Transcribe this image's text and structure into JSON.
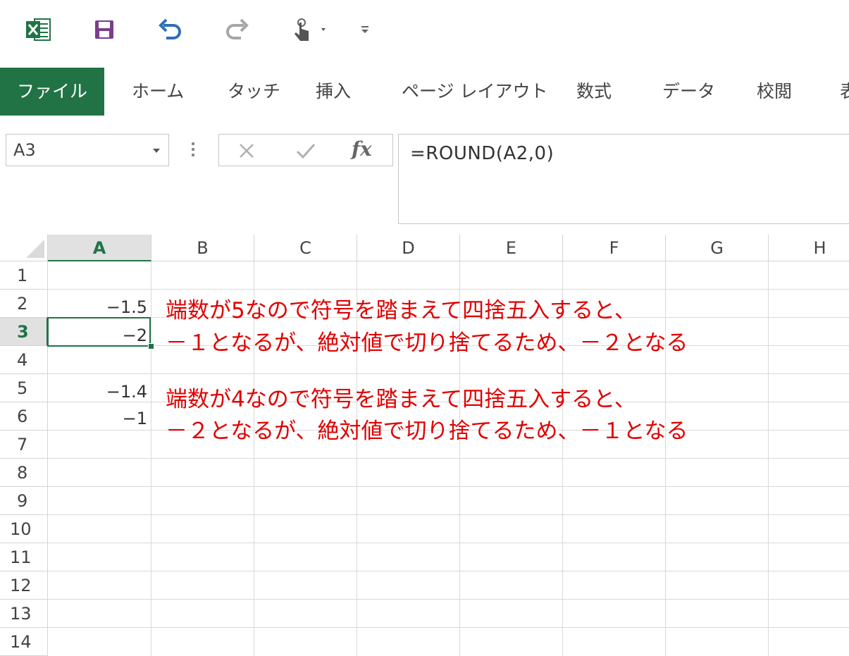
{
  "colors": {
    "accent": "#217346",
    "annotation": "#e00000",
    "save_purple": "#7a3d8f",
    "undo_blue": "#2e6fb7"
  },
  "qat": {
    "items": [
      "excel-icon",
      "save-icon",
      "undo-icon",
      "redo-icon",
      "touch-mode-icon",
      "customize-qat-icon"
    ]
  },
  "ribbon": {
    "tabs": [
      "ファイル",
      "ホーム",
      "タッチ",
      "挿入",
      "ページ レイアウト",
      "数式",
      "データ",
      "校閲",
      "表"
    ]
  },
  "formula_bar": {
    "name_box": "A3",
    "fx_label": "fx",
    "formula": "=ROUND(A2,0)"
  },
  "grid": {
    "columns": [
      "A",
      "B",
      "C",
      "D",
      "E",
      "F",
      "G",
      "H"
    ],
    "active_column": "A",
    "rows": [
      "1",
      "2",
      "3",
      "4",
      "5",
      "6",
      "7",
      "8",
      "9",
      "10",
      "11",
      "12",
      "13",
      "14"
    ],
    "active_row": "3",
    "cells": {
      "A2": "−1.5",
      "A3": "−2",
      "A5": "−1.4",
      "A6": "−1"
    }
  },
  "annotations": {
    "line1": "端数が5なので符号を踏まえて四捨五入すると、",
    "line2": "－１となるが、絶対値で切り捨てるため、－２となる",
    "line3": "端数が4なので符号を踏まえて四捨五入すると、",
    "line4": "－２となるが、絶対値で切り捨てるため、－１となる"
  }
}
